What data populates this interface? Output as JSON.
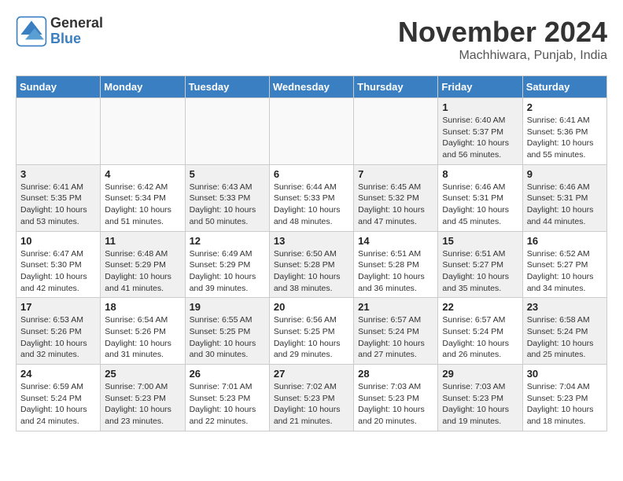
{
  "header": {
    "logo_general": "General",
    "logo_blue": "Blue",
    "month_title": "November 2024",
    "location": "Machhiwara, Punjab, India"
  },
  "weekdays": [
    "Sunday",
    "Monday",
    "Tuesday",
    "Wednesday",
    "Thursday",
    "Friday",
    "Saturday"
  ],
  "weeks": [
    {
      "days": [
        {
          "num": "",
          "info": "",
          "empty": true
        },
        {
          "num": "",
          "info": "",
          "empty": true
        },
        {
          "num": "",
          "info": "",
          "empty": true
        },
        {
          "num": "",
          "info": "",
          "empty": true
        },
        {
          "num": "",
          "info": "",
          "empty": true
        },
        {
          "num": "1",
          "info": "Sunrise: 6:40 AM\nSunset: 5:37 PM\nDaylight: 10 hours\nand 56 minutes.",
          "shaded": true
        },
        {
          "num": "2",
          "info": "Sunrise: 6:41 AM\nSunset: 5:36 PM\nDaylight: 10 hours\nand 55 minutes.",
          "shaded": false
        }
      ]
    },
    {
      "days": [
        {
          "num": "3",
          "info": "Sunrise: 6:41 AM\nSunset: 5:35 PM\nDaylight: 10 hours\nand 53 minutes.",
          "shaded": true
        },
        {
          "num": "4",
          "info": "Sunrise: 6:42 AM\nSunset: 5:34 PM\nDaylight: 10 hours\nand 51 minutes.",
          "shaded": false
        },
        {
          "num": "5",
          "info": "Sunrise: 6:43 AM\nSunset: 5:33 PM\nDaylight: 10 hours\nand 50 minutes.",
          "shaded": true
        },
        {
          "num": "6",
          "info": "Sunrise: 6:44 AM\nSunset: 5:33 PM\nDaylight: 10 hours\nand 48 minutes.",
          "shaded": false
        },
        {
          "num": "7",
          "info": "Sunrise: 6:45 AM\nSunset: 5:32 PM\nDaylight: 10 hours\nand 47 minutes.",
          "shaded": true
        },
        {
          "num": "8",
          "info": "Sunrise: 6:46 AM\nSunset: 5:31 PM\nDaylight: 10 hours\nand 45 minutes.",
          "shaded": false
        },
        {
          "num": "9",
          "info": "Sunrise: 6:46 AM\nSunset: 5:31 PM\nDaylight: 10 hours\nand 44 minutes.",
          "shaded": true
        }
      ]
    },
    {
      "days": [
        {
          "num": "10",
          "info": "Sunrise: 6:47 AM\nSunset: 5:30 PM\nDaylight: 10 hours\nand 42 minutes.",
          "shaded": false
        },
        {
          "num": "11",
          "info": "Sunrise: 6:48 AM\nSunset: 5:29 PM\nDaylight: 10 hours\nand 41 minutes.",
          "shaded": true
        },
        {
          "num": "12",
          "info": "Sunrise: 6:49 AM\nSunset: 5:29 PM\nDaylight: 10 hours\nand 39 minutes.",
          "shaded": false
        },
        {
          "num": "13",
          "info": "Sunrise: 6:50 AM\nSunset: 5:28 PM\nDaylight: 10 hours\nand 38 minutes.",
          "shaded": true
        },
        {
          "num": "14",
          "info": "Sunrise: 6:51 AM\nSunset: 5:28 PM\nDaylight: 10 hours\nand 36 minutes.",
          "shaded": false
        },
        {
          "num": "15",
          "info": "Sunrise: 6:51 AM\nSunset: 5:27 PM\nDaylight: 10 hours\nand 35 minutes.",
          "shaded": true
        },
        {
          "num": "16",
          "info": "Sunrise: 6:52 AM\nSunset: 5:27 PM\nDaylight: 10 hours\nand 34 minutes.",
          "shaded": false
        }
      ]
    },
    {
      "days": [
        {
          "num": "17",
          "info": "Sunrise: 6:53 AM\nSunset: 5:26 PM\nDaylight: 10 hours\nand 32 minutes.",
          "shaded": true
        },
        {
          "num": "18",
          "info": "Sunrise: 6:54 AM\nSunset: 5:26 PM\nDaylight: 10 hours\nand 31 minutes.",
          "shaded": false
        },
        {
          "num": "19",
          "info": "Sunrise: 6:55 AM\nSunset: 5:25 PM\nDaylight: 10 hours\nand 30 minutes.",
          "shaded": true
        },
        {
          "num": "20",
          "info": "Sunrise: 6:56 AM\nSunset: 5:25 PM\nDaylight: 10 hours\nand 29 minutes.",
          "shaded": false
        },
        {
          "num": "21",
          "info": "Sunrise: 6:57 AM\nSunset: 5:24 PM\nDaylight: 10 hours\nand 27 minutes.",
          "shaded": true
        },
        {
          "num": "22",
          "info": "Sunrise: 6:57 AM\nSunset: 5:24 PM\nDaylight: 10 hours\nand 26 minutes.",
          "shaded": false
        },
        {
          "num": "23",
          "info": "Sunrise: 6:58 AM\nSunset: 5:24 PM\nDaylight: 10 hours\nand 25 minutes.",
          "shaded": true
        }
      ]
    },
    {
      "days": [
        {
          "num": "24",
          "info": "Sunrise: 6:59 AM\nSunset: 5:24 PM\nDaylight: 10 hours\nand 24 minutes.",
          "shaded": false
        },
        {
          "num": "25",
          "info": "Sunrise: 7:00 AM\nSunset: 5:23 PM\nDaylight: 10 hours\nand 23 minutes.",
          "shaded": true
        },
        {
          "num": "26",
          "info": "Sunrise: 7:01 AM\nSunset: 5:23 PM\nDaylight: 10 hours\nand 22 minutes.",
          "shaded": false
        },
        {
          "num": "27",
          "info": "Sunrise: 7:02 AM\nSunset: 5:23 PM\nDaylight: 10 hours\nand 21 minutes.",
          "shaded": true
        },
        {
          "num": "28",
          "info": "Sunrise: 7:03 AM\nSunset: 5:23 PM\nDaylight: 10 hours\nand 20 minutes.",
          "shaded": false
        },
        {
          "num": "29",
          "info": "Sunrise: 7:03 AM\nSunset: 5:23 PM\nDaylight: 10 hours\nand 19 minutes.",
          "shaded": true
        },
        {
          "num": "30",
          "info": "Sunrise: 7:04 AM\nSunset: 5:23 PM\nDaylight: 10 hours\nand 18 minutes.",
          "shaded": false
        }
      ]
    }
  ]
}
